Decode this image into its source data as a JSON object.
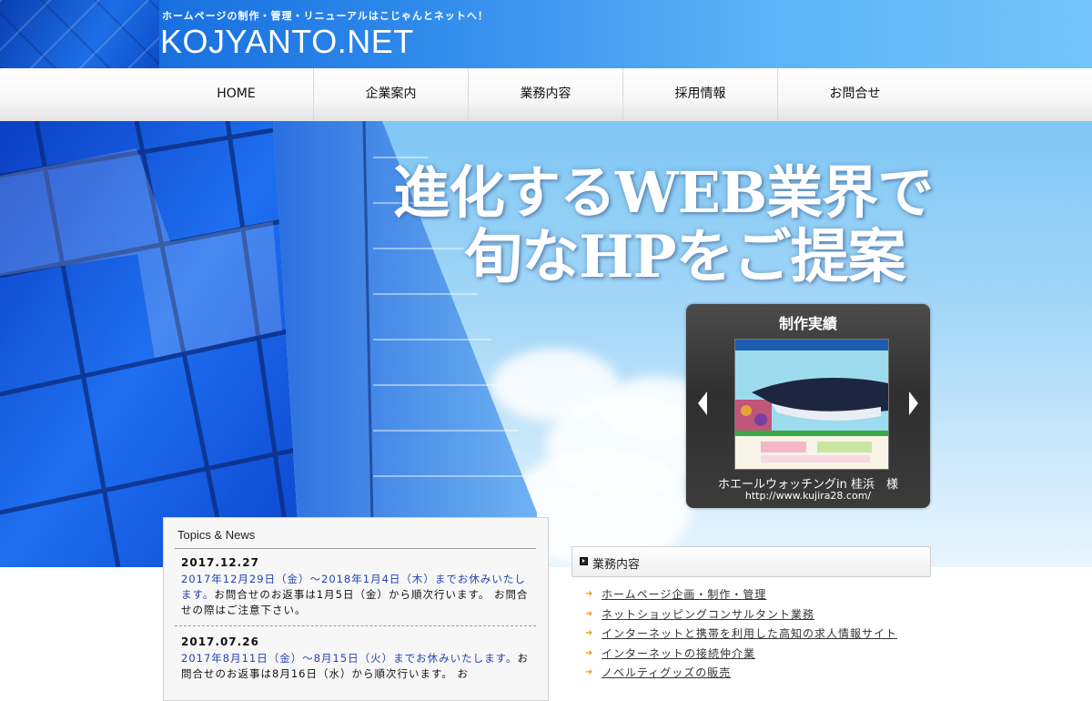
{
  "header": {
    "tagline": "ホームページの制作・管理・リニューアルはこじゃんとネットへ！",
    "logo": "KOJYANTO.NET"
  },
  "nav": {
    "items": [
      {
        "label": "HOME"
      },
      {
        "label": "企業案内"
      },
      {
        "label": "業務内容"
      },
      {
        "label": "採用情報"
      },
      {
        "label": "お問合せ"
      }
    ]
  },
  "hero": {
    "line1": "進化するWEB業界で",
    "line2": "旬なHPをご提案"
  },
  "works": {
    "title": "制作実績",
    "caption": "ホエールウォッチングin 桂浜　様",
    "url": "http://www.kujira28.com/"
  },
  "topics": {
    "title": "Topics & News",
    "items": [
      {
        "date": "2017.12.27",
        "highlight": "2017年12月29日（金）〜2018年1月4日（木）までお休みいたします。",
        "body": "お問合せのお返事は1月5日（金）から順次行います。 お問合せの際はご注意下さい。"
      },
      {
        "date": "2017.07.26",
        "highlight": "2017年8月11日（金）〜8月15日（火）までお休みいたします。",
        "body": "お問合せのお返事は8月16日（水）から順次行います。 お"
      }
    ]
  },
  "business": {
    "title": "業務内容",
    "items": [
      "ホームページ企画・制作・管理",
      "ネットショッピングコンサルタント業務",
      "インターネットと携帯を利用した高知の求人情報サイト",
      "インターネットの接続仲介業",
      "ノベルティグッズの販売"
    ]
  },
  "colors": {
    "header_blue": "#2b86ea",
    "news_highlight": "#2342b8",
    "bullet_orange": "#f19a1a",
    "works_panel": "#3b3b3b"
  }
}
